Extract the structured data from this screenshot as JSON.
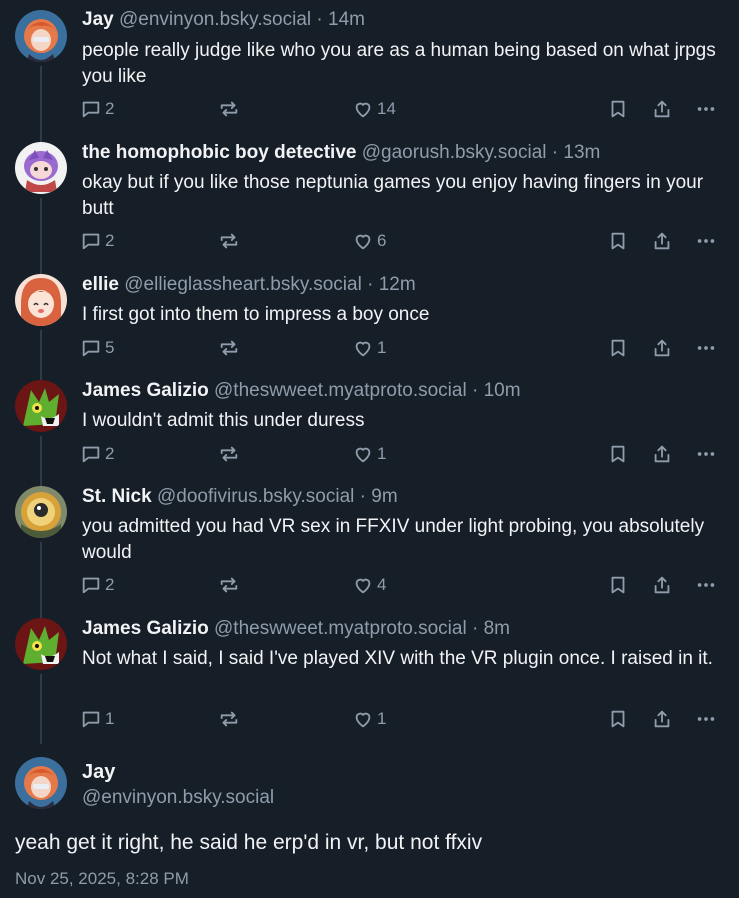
{
  "posts": [
    {
      "name": "Jay",
      "handle": "@envinyon.bsky.social",
      "time": "14m",
      "text": "people really judge like who you are as a human being based on what jrpgs you like",
      "replies": "2",
      "reposts": "",
      "likes": "14",
      "avatar": "jay"
    },
    {
      "name": "the homophobic boy detective",
      "handle": "@gaorush.bsky.social",
      "time": "13m",
      "text": "okay but if you like those neptunia games you enjoy having fingers in your butt",
      "replies": "2",
      "reposts": "",
      "likes": "6",
      "avatar": "detective"
    },
    {
      "name": "ellie",
      "handle": "@ellieglassheart.bsky.social",
      "time": "12m",
      "text": "I first got into them to impress a boy once",
      "replies": "5",
      "reposts": "",
      "likes": "1",
      "avatar": "ellie"
    },
    {
      "name": "James Galizio",
      "handle": "@theswweet.myatproto.social",
      "time": "10m",
      "text": "I wouldn't admit this under duress",
      "replies": "2",
      "reposts": "",
      "likes": "1",
      "avatar": "james"
    },
    {
      "name": "St. Nick",
      "handle": "@doofivirus.bsky.social",
      "time": "9m",
      "text": "you admitted you had VR sex in FFXIV under light probing, you absolutely would",
      "replies": "2",
      "reposts": "",
      "likes": "4",
      "avatar": "nick"
    },
    {
      "name": "James Galizio",
      "handle": "@theswweet.myatproto.social",
      "time": "8m",
      "text": "Not what I said, I said I've played XIV with the VR plugin once. I raised in it.",
      "replies": "1",
      "reposts": "",
      "likes": "1",
      "avatar": "james"
    }
  ],
  "separator": "·",
  "main_post": {
    "name": "Jay",
    "handle": "@envinyon.bsky.social",
    "text": "yeah get it right, he said he erp'd in vr, but not ffxiv",
    "date": "Nov 25, 2025, 8:28 PM"
  },
  "colors": {
    "background": "#161e27",
    "text": "#f1f3f5",
    "muted": "#8e9cab",
    "thread_line": "#2e3b49"
  },
  "icons": [
    "reply-icon",
    "repost-icon",
    "like-icon",
    "bookmark-icon",
    "share-icon",
    "more-icon"
  ]
}
